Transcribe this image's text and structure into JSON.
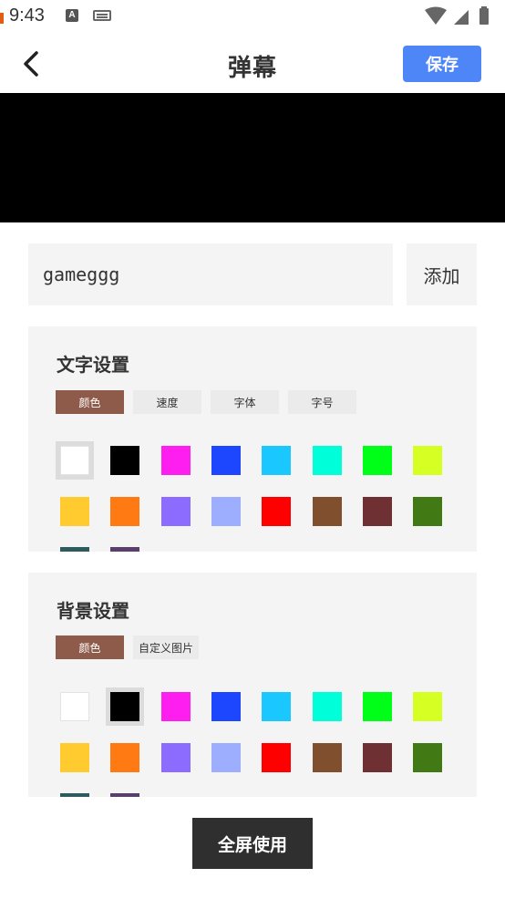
{
  "status": {
    "time": "9:43",
    "a_icon": "A"
  },
  "header": {
    "title": "弹幕",
    "save_label": "保存"
  },
  "input": {
    "value": "gameggg",
    "add_label": "添加"
  },
  "text_settings": {
    "title": "文字设置",
    "tabs": [
      "颜色",
      "速度",
      "字体",
      "字号"
    ],
    "selected_index": 0
  },
  "bg_settings": {
    "title": "背景设置",
    "tabs": [
      "颜色",
      "自定义图片"
    ],
    "selected_index": 1
  },
  "colors": [
    "#ffffff",
    "#000000",
    "#ff1ef0",
    "#1c47ff",
    "#1ac7ff",
    "#00ffd8",
    "#00ff18",
    "#d6ff23",
    "#ffcb2e",
    "#ff7a12",
    "#8c6cff",
    "#9eaeff",
    "#ff0000",
    "#7f4f2e",
    "#6f3034",
    "#417a14",
    "#2e5c5e",
    "#5a3f6c"
  ],
  "accent_color": "#4f86f7",
  "tab_active_color": "#8e5a4a",
  "fullscreen_label": "全屏使用"
}
